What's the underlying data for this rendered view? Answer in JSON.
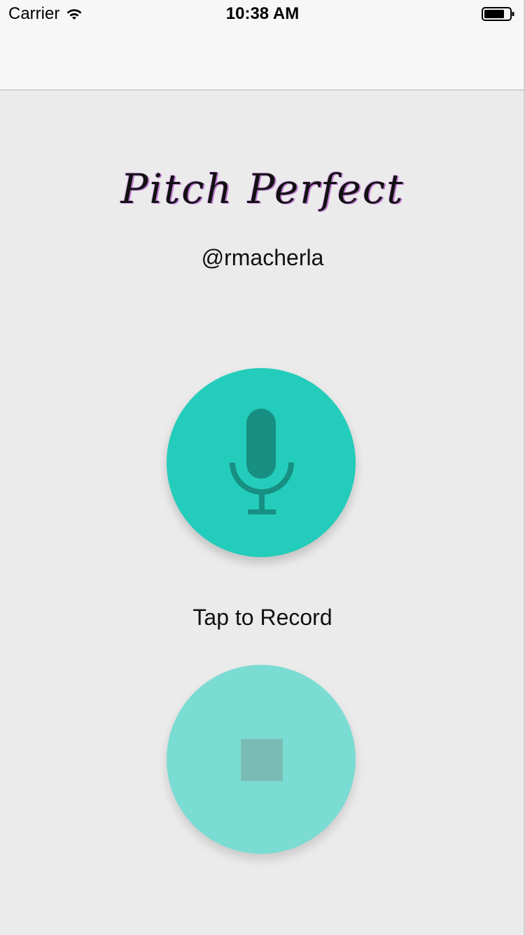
{
  "status_bar": {
    "carrier": "Carrier",
    "time": "10:38 AM",
    "wifi_icon": "wifi-icon",
    "battery_icon": "battery-icon"
  },
  "header": {
    "title": "Pitch Perfect",
    "handle": "@rmacherla"
  },
  "record": {
    "icon": "microphone-icon",
    "label": "Tap to Record"
  },
  "stop": {
    "icon": "stop-icon"
  },
  "colors": {
    "background": "#ebebeb",
    "record_button": "#23ccbb",
    "mic_glyph": "#178f82",
    "stop_button": "#7adcd3",
    "stop_glyph": "#7abcb4"
  }
}
